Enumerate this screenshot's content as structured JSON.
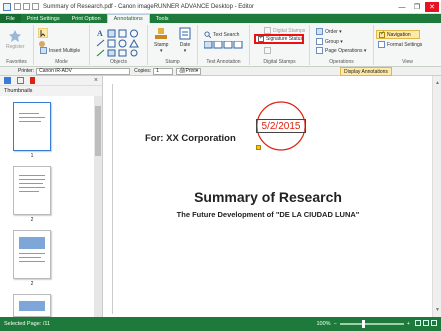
{
  "window": {
    "title": "Summary of Research.pdf - Canon imageRUNNER ADVANCE Desktop - Editor",
    "minimize_icon": "minimize-icon",
    "restore_icon": "restore-icon",
    "close_icon": "close-icon"
  },
  "tabs": [
    {
      "label": "File"
    },
    {
      "label": "Print Settings"
    },
    {
      "label": "Print Option"
    },
    {
      "label": "Annotations"
    },
    {
      "label": "Tools"
    }
  ],
  "ribbon": {
    "favorites": {
      "register": "Register",
      "group_label": "Favorites"
    },
    "mode": {
      "insert_multiple": "Insert Multiple",
      "group_label": "Mode"
    },
    "objects": {
      "group_label": "Objects"
    },
    "stamp": {
      "stamp": "Stamp",
      "date": "Date",
      "group_label": "Stamp"
    },
    "text_annotation": {
      "text_search": "Text Search",
      "group_label": "Text Annotation"
    },
    "digital_stamps": {
      "digital_stamps": "Digital Stamps",
      "signature_status": "Signature Status",
      "group_label": "Digital Stamps"
    },
    "operations": {
      "order": "Order",
      "group": "Group",
      "page_operations": "Page Operations",
      "group_label": "Operations"
    },
    "view": {
      "navigation": "Navigation",
      "format_settings": "Format Settings",
      "group_label": "View"
    }
  },
  "toolbar2": {
    "printer_label": "Printer:",
    "printer_value": "Canon iR-ADV",
    "copies_label": "Copies:",
    "copies_value": "1",
    "print_label": "Print",
    "display_annotations": "Display Annotations"
  },
  "left_pane": {
    "header": "Thumbnails",
    "thumbnails": [
      {
        "label": "1"
      },
      {
        "label": "2"
      },
      {
        "label": "2"
      },
      {
        "label": ""
      }
    ]
  },
  "document": {
    "for_text": "For: XX Corporation",
    "stamp_date": "5/2/2015",
    "title": "Summary of Research",
    "subtitle": "The Future Development of \"DE LA CIUDAD LUNA\""
  },
  "status": {
    "selected_page": "Selected Page: /11",
    "zoom": "100%"
  },
  "colors": {
    "brand_green": "#1d7a3a",
    "stamp_red": "#d21",
    "highlight_red": "#e11"
  }
}
